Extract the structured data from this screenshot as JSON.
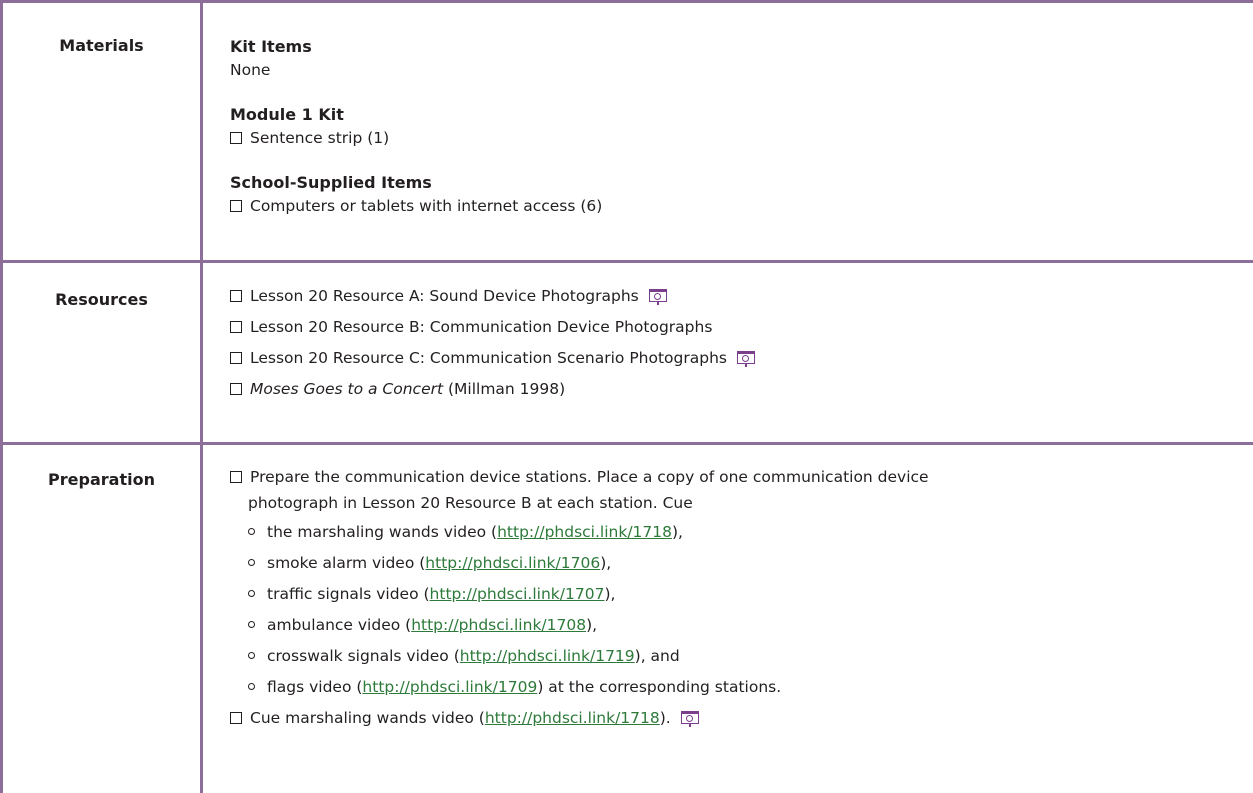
{
  "materials": {
    "label": "Materials",
    "kit_items_heading": "Kit Items",
    "kit_items_value": "None",
    "module_kit_heading": "Module 1 Kit",
    "module_kit_items": [
      "Sentence strip (1)"
    ],
    "school_heading": "School-Supplied Items",
    "school_items": [
      "Computers or tablets with internet access (6)"
    ]
  },
  "resources": {
    "label": "Resources",
    "items": [
      {
        "text": "Lesson 20 Resource A: Sound Device Photographs",
        "projector": true
      },
      {
        "text": "Lesson 20 Resource B: Communication Device Photographs",
        "projector": false
      },
      {
        "text": "Lesson 20 Resource C: Communication Scenario Photographs",
        "projector": true
      },
      {
        "title": "Moses Goes to a Concert",
        "rest": " (Millman 1998)"
      }
    ]
  },
  "preparation": {
    "label": "Preparation",
    "step1_line1": "Prepare the communication device stations. Place a copy of one communication device",
    "step1_line2": "photograph in Lesson 20 Resource B at each station. Cue",
    "videos": [
      {
        "before": "the marshaling wands video (",
        "url": "http://phdsci.link/1718",
        "after": "),"
      },
      {
        "before": "smoke alarm video (",
        "url": "http://phdsci.link/1706",
        "after": "),"
      },
      {
        "before": "traffic signals video (",
        "url": "http://phdsci.link/1707",
        "after": "),"
      },
      {
        "before": "ambulance video (",
        "url": "http://phdsci.link/1708",
        "after": "),"
      },
      {
        "before": "crosswalk signals video (",
        "url": "http://phdsci.link/1719",
        "after": "), and"
      },
      {
        "before": "flags video (",
        "url": "http://phdsci.link/1709",
        "after": ") at the corresponding stations."
      }
    ],
    "step2_before": "Cue marshaling wands video (",
    "step2_url": "http://phdsci.link/1718",
    "step2_after": ")."
  },
  "colors": {
    "rule": "#8b6f9a",
    "link": "#2d7a3a",
    "icon": "#7a3e8c",
    "text": "#231f20"
  },
  "icons": [
    "checkbox-icon",
    "projector-icon",
    "bullet-circle-icon"
  ]
}
